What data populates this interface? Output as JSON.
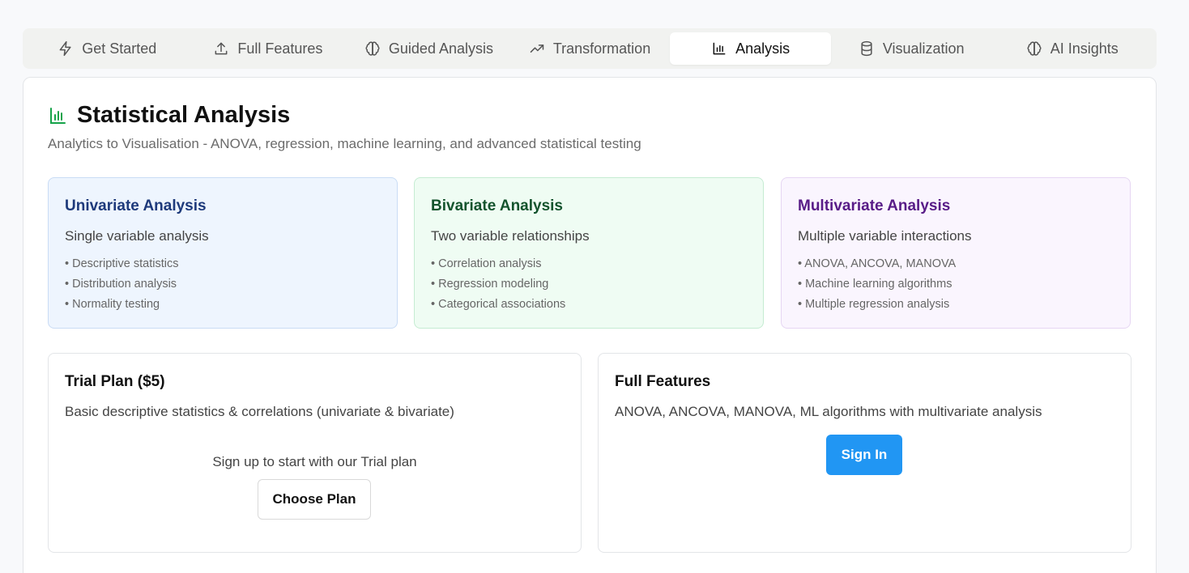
{
  "tabs": [
    {
      "label": "Get Started",
      "icon": "lightning-icon"
    },
    {
      "label": "Full Features",
      "icon": "upload-icon"
    },
    {
      "label": "Guided Analysis",
      "icon": "brain-icon"
    },
    {
      "label": "Transformation",
      "icon": "trending-up-icon"
    },
    {
      "label": "Analysis",
      "icon": "bar-chart-icon",
      "active": true
    },
    {
      "label": "Visualization",
      "icon": "database-icon"
    },
    {
      "label": "AI Insights",
      "icon": "brain-icon"
    }
  ],
  "header": {
    "title": "Statistical Analysis",
    "subtitle": "Analytics to Visualisation - ANOVA, regression, machine learning, and advanced statistical testing",
    "icon": "bar-chart-icon",
    "icon_color": "#16a34a"
  },
  "cards": [
    {
      "title": "Univariate Analysis",
      "subtitle": "Single variable analysis",
      "items": [
        "• Descriptive statistics",
        "• Distribution analysis",
        "• Normality testing"
      ],
      "accent": "#1e3a7b"
    },
    {
      "title": "Bivariate Analysis",
      "subtitle": "Two variable relationships",
      "items": [
        "• Correlation analysis",
        "• Regression modeling",
        "• Categorical associations"
      ],
      "accent": "#14532d"
    },
    {
      "title": "Multivariate Analysis",
      "subtitle": "Multiple variable interactions",
      "items": [
        "• ANOVA, ANCOVA, MANOVA",
        "• Machine learning algorithms",
        "• Multiple regression analysis"
      ],
      "accent": "#581c87"
    }
  ],
  "trial_plan": {
    "title": "Trial Plan ($5)",
    "description": "Basic descriptive statistics & correlations (univariate & bivariate)",
    "signup_text": "Sign up to start with our Trial plan",
    "button_label": "Choose Plan"
  },
  "full_plan": {
    "title": "Full Features",
    "description": "ANOVA, ANCOVA, MANOVA, ML algorithms with multivariate analysis",
    "button_label": "Sign In",
    "button_color": "#2196f3"
  }
}
